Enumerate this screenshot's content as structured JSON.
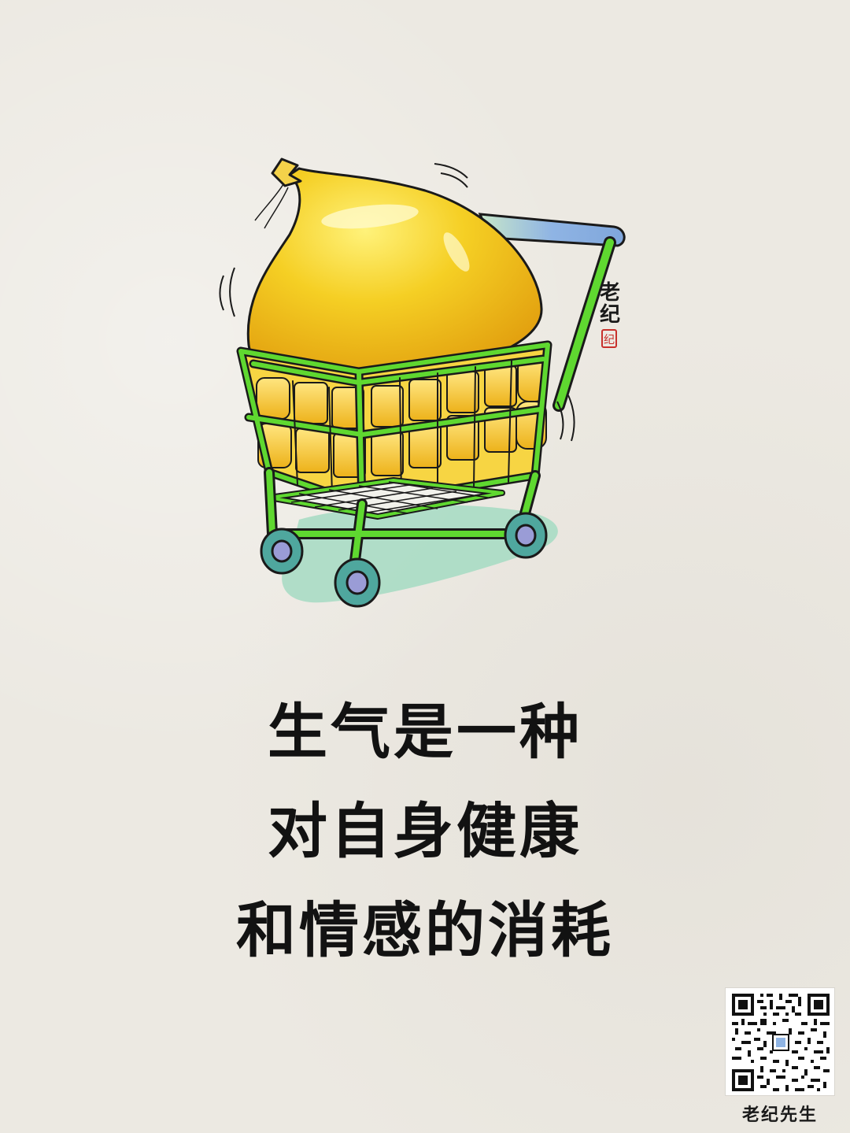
{
  "caption": {
    "lines": [
      "生气是一种",
      "对自身健康",
      "和情感的消耗"
    ]
  },
  "signature": {
    "artist": "老纪",
    "seal": "纪"
  },
  "qr": {
    "label": "老纪先生"
  },
  "colors": {
    "background": "#ECE9E2",
    "bag_yellow": "#F2C21B",
    "cart_green": "#5FD830",
    "shadow_teal": "#A9DCC4",
    "handle_blue": "#8FB4E4",
    "seal_red": "#C8302C",
    "text": "#121212"
  },
  "icons": [
    "shopping-cart-illustration",
    "balloon-bag-illustration",
    "qr-code",
    "artist-seal"
  ]
}
